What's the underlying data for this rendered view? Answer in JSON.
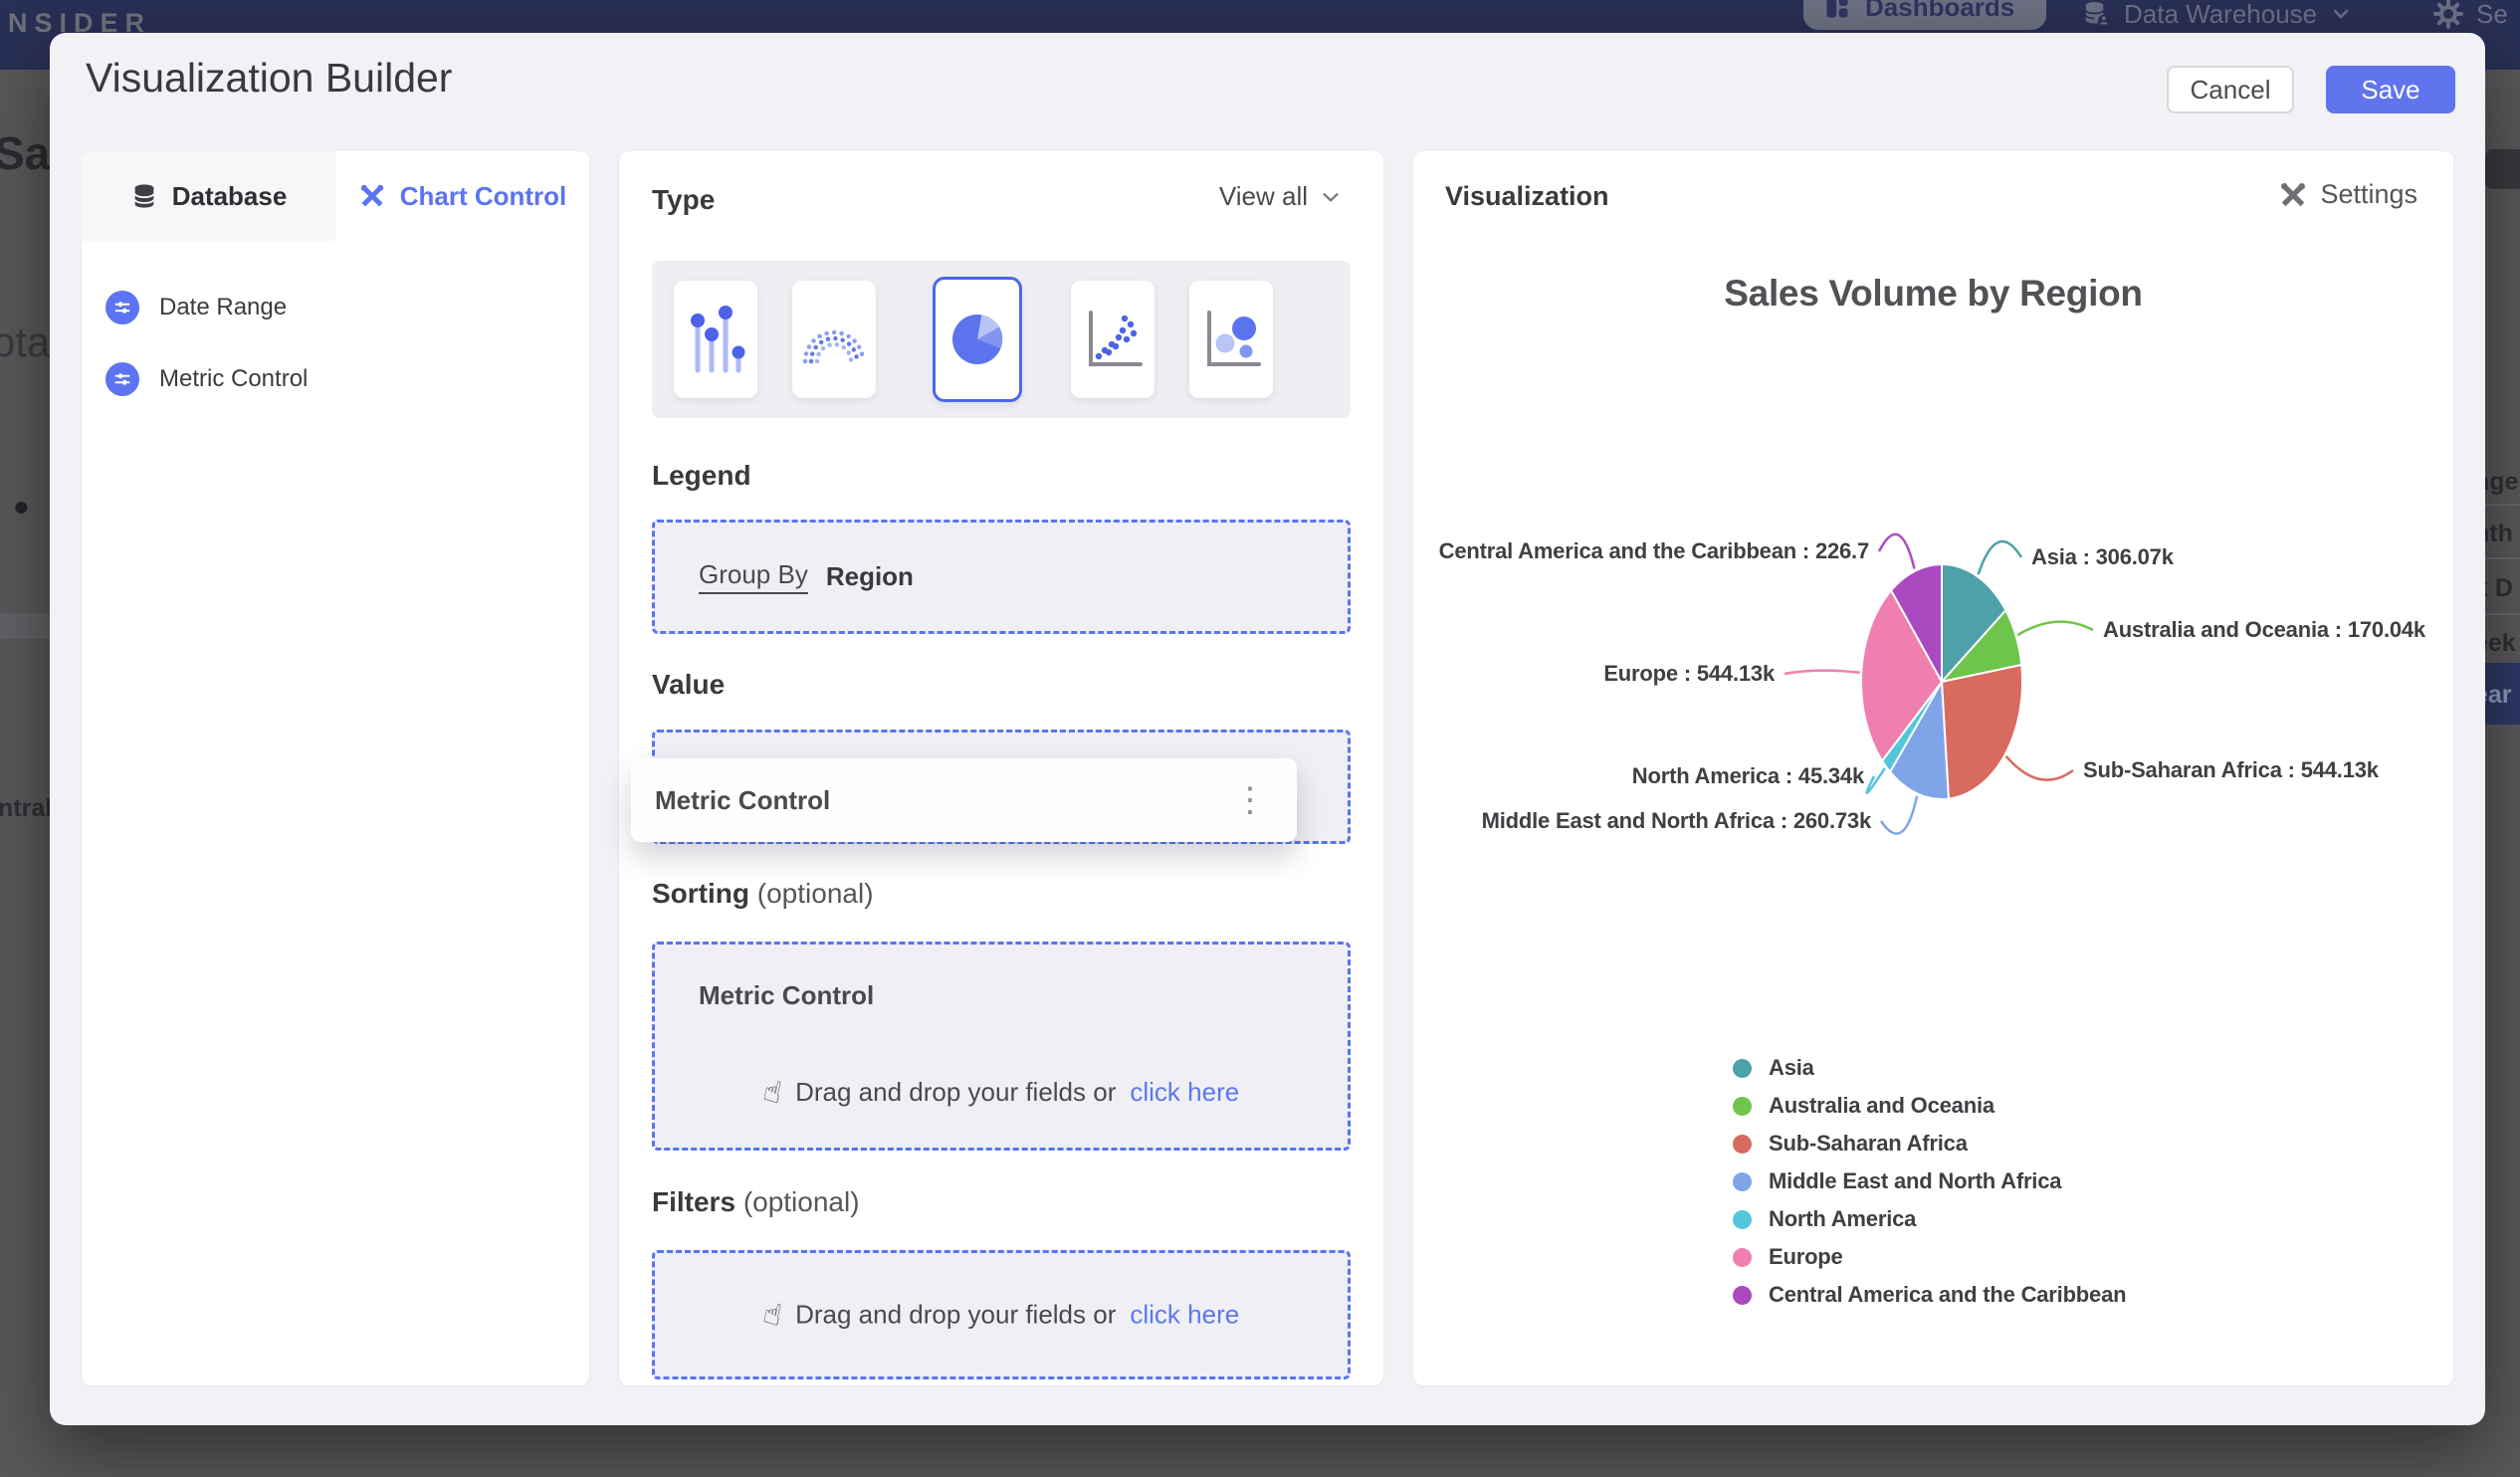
{
  "navbar": {
    "logo": "NSIDER",
    "dashboards": "Dashboards",
    "data_warehouse": "Data Warehouse",
    "settings_partial": "Se"
  },
  "modal": {
    "title": "Visualization Builder",
    "cancel": "Cancel",
    "save": "Save"
  },
  "sidebar": {
    "tabs": [
      {
        "label": "Database"
      },
      {
        "label": "Chart Control"
      }
    ],
    "items": [
      {
        "label": "Date Range"
      },
      {
        "label": "Metric Control"
      }
    ]
  },
  "builder": {
    "type_heading": "Type",
    "view_all": "View all",
    "chart_types": [
      "lollipop",
      "arc-dots",
      "pie",
      "scatter",
      "bubble"
    ],
    "selected_type": "pie",
    "legend_heading": "Legend",
    "group_by": "Group By",
    "group_by_value": "Region",
    "value_heading": "Value",
    "value_ghost": "Metric Control",
    "drag_chip": "Metric Control",
    "sorting_heading": "Sorting",
    "sorting_optional": "(optional)",
    "sorting_field": "Metric Control",
    "filters_heading": "Filters",
    "filters_optional": "(optional)",
    "drop_hint": "Drag and drop your fields or",
    "drop_link": "click here"
  },
  "viz_panel": {
    "heading": "Visualization",
    "settings": "Settings"
  },
  "background": {
    "left_fragments": [
      "Sal",
      "ota",
      "•",
      "ntral"
    ],
    "right_menu_fragments": [
      "nge",
      "nth",
      "k D",
      "eek",
      "ear"
    ]
  },
  "chart_data": {
    "type": "pie",
    "title": "Sales Volume by Region",
    "value_unit": "k",
    "legend_position": "bottom",
    "slices": [
      {
        "label": "Asia",
        "value": 306.07,
        "display": "Asia : 306.07k",
        "color": "#4DA1A8"
      },
      {
        "label": "Australia and Oceania",
        "value": 170.04,
        "display": "Australia and Oceania : 170.04k",
        "color": "#6FC54B"
      },
      {
        "label": "Sub-Saharan Africa",
        "value": 544.13,
        "display": "Sub-Saharan Africa : 544.13k",
        "color": "#D96A60"
      },
      {
        "label": "Middle East and North Africa",
        "value": 260.73,
        "display": "Middle East and North Africa : 260.73k",
        "color": "#7FA5E8"
      },
      {
        "label": "North America",
        "value": 45.34,
        "display": "North America : 45.34k",
        "color": "#53C6D9"
      },
      {
        "label": "Europe",
        "value": 544.13,
        "display": "Europe : 544.13k",
        "color": "#EF7FAF"
      },
      {
        "label": "Central America and the Caribbean",
        "value": 226.73,
        "display": "Central America and the Caribbean : 226.7",
        "color": "#AB4AC0"
      }
    ]
  }
}
